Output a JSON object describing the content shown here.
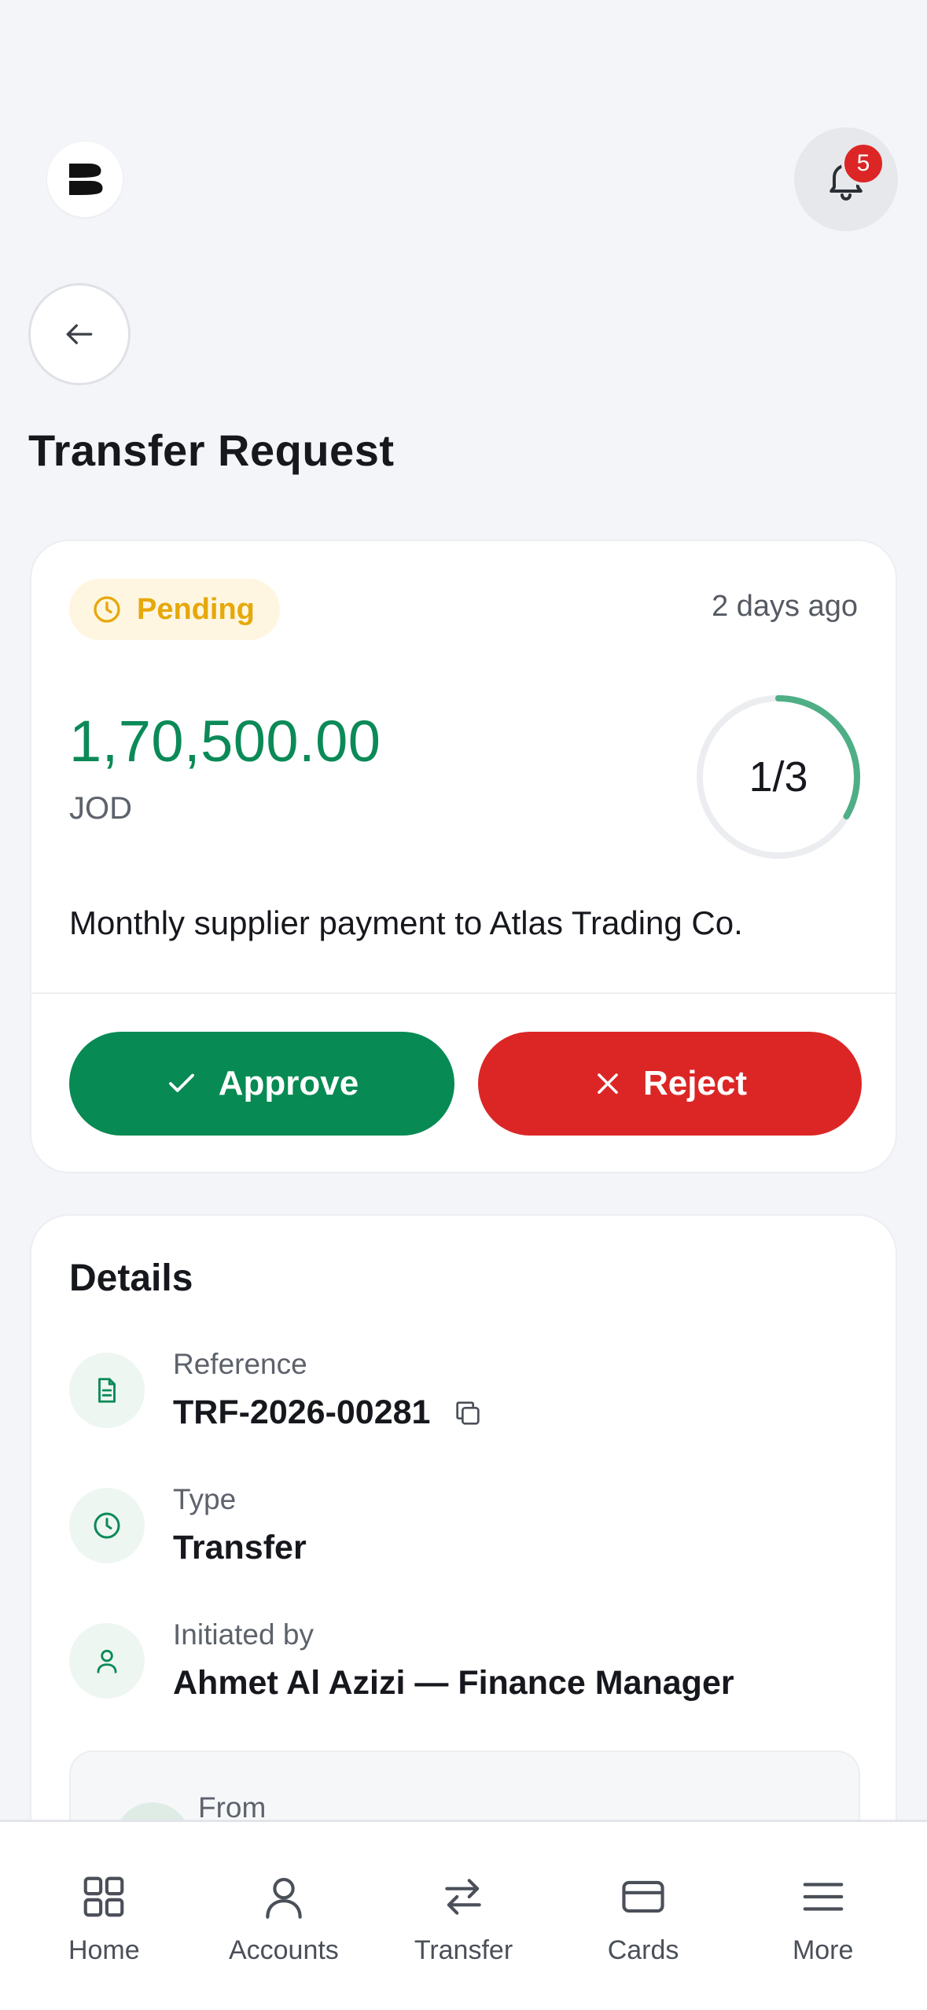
{
  "header": {
    "notifications_count": "5"
  },
  "page": {
    "title": "Transfer Request"
  },
  "request": {
    "status": "Pending",
    "time_ago": "2 days ago",
    "amount": "1,70,500.00",
    "currency": "JOD",
    "approvals_label": "1/3",
    "approvals_done": 1,
    "approvals_total": 3,
    "description": "Monthly supplier payment to Atlas Trading Co.",
    "approve_label": "Approve",
    "reject_label": "Reject"
  },
  "details": {
    "title": "Details",
    "reference_label": "Reference",
    "reference_value": "TRF-2026-00281",
    "type_label": "Type",
    "type_value": "Transfer",
    "initiated_label": "Initiated by",
    "initiated_value": "Ahmet Al Azizi — Finance Manager",
    "from_label": "From"
  },
  "tabs": [
    {
      "label": "Home",
      "icon": "grid-icon"
    },
    {
      "label": "Accounts",
      "icon": "user-icon"
    },
    {
      "label": "Transfer",
      "icon": "transfer-icon"
    },
    {
      "label": "Cards",
      "icon": "card-icon"
    },
    {
      "label": "More",
      "icon": "menu-icon"
    }
  ],
  "colors": {
    "success": "#078a53",
    "danger": "#dc2626",
    "pending": "#e6a80a",
    "background": "#f4f5f8"
  }
}
